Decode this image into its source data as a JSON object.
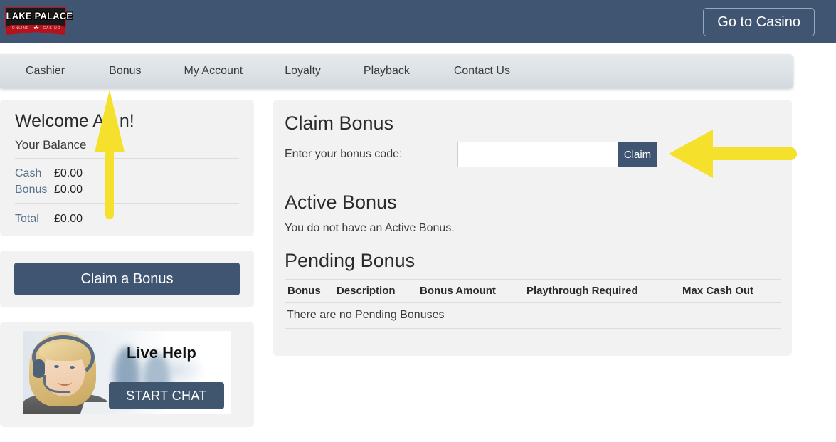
{
  "header": {
    "logo": {
      "name": "LAKE PALACE",
      "tagline_left": "ONLINE",
      "tagline_right": "CASINO",
      "leaf_glyph": "☘"
    },
    "go_to_casino_label": "Go to Casino",
    "background_color": "#3f5571"
  },
  "nav": {
    "items": [
      {
        "label": "Cashier"
      },
      {
        "label": "Bonus"
      },
      {
        "label": "My Account"
      },
      {
        "label": "Loyalty"
      },
      {
        "label": "Playback"
      },
      {
        "label": "Contact Us"
      }
    ]
  },
  "sidebar": {
    "welcome_title": "Welcome A   n!",
    "your_balance_label": "Your Balance",
    "balance_rows": [
      {
        "label": "Cash",
        "value": "£0.00"
      },
      {
        "label": "Bonus",
        "value": "£0.00"
      }
    ],
    "total_row": {
      "label": "Total",
      "value": "£0.00"
    },
    "claim_a_bonus_label": "Claim a Bonus",
    "live_help": {
      "title": "Live Help",
      "start_chat_label": "START CHAT"
    }
  },
  "main": {
    "claim_bonus_heading": "Claim Bonus",
    "bonus_code_label": "Enter your bonus code:",
    "bonus_code_value": "",
    "bonus_code_placeholder": "",
    "claim_button_label": "Claim",
    "active_bonus_heading": "Active Bonus",
    "active_bonus_message": "You do not have an Active Bonus.",
    "pending_bonus_heading": "Pending Bonus",
    "pending_table": {
      "columns": [
        "Bonus",
        "Description",
        "Bonus Amount",
        "Playthrough Required",
        "Max Cash Out"
      ],
      "empty_message": "There are no Pending Bonuses",
      "rows": []
    }
  },
  "annotations": {
    "arrow_color": "#f5e02b",
    "up_arrow_target": "Bonus",
    "right_arrow_target": "Claim"
  }
}
